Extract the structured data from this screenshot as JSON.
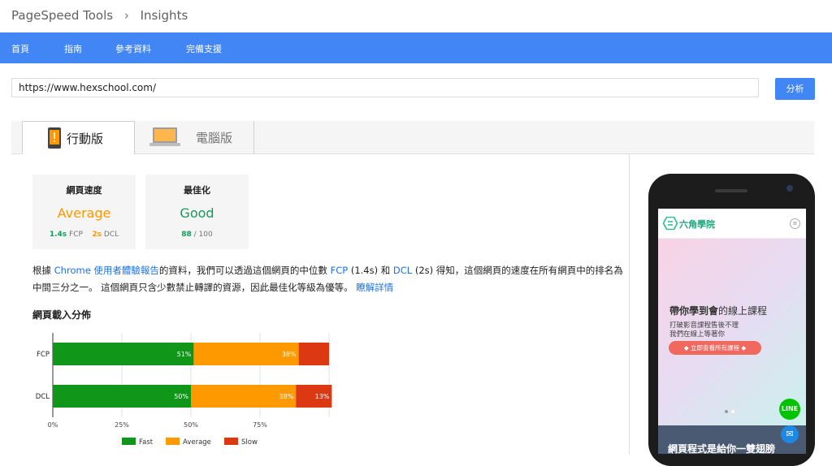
{
  "breadcrumb": {
    "root": "PageSpeed Tools",
    "separator": "›",
    "current": "Insights"
  },
  "nav": {
    "items": [
      "首頁",
      "指南",
      "參考資料",
      "完備支援"
    ]
  },
  "search": {
    "url": "https://www.hexschool.com/",
    "button_label": "分析"
  },
  "tabs": [
    {
      "label": "行動版",
      "icon": "mobile-phone-icon",
      "active": true
    },
    {
      "label": "電腦版",
      "icon": "laptop-icon",
      "active": false
    }
  ],
  "cards": {
    "speed": {
      "title": "網頁速度",
      "value": "Average",
      "fcp_value": "1.4s",
      "fcp_label": "FCP",
      "dcl_value": "2s",
      "dcl_label": "DCL",
      "color": "#ff9800"
    },
    "optimization": {
      "title": "最佳化",
      "value": "Good",
      "score": "88",
      "score_total": "/ 100",
      "color": "#0f9d58"
    }
  },
  "summary": {
    "p1": "根據 ",
    "link_report": "Chrome 使用者體驗報告",
    "p2": "的資料，我們可以透過這個網頁的中位數 ",
    "link_fcp": "FCP",
    "p3": " (1.4s) 和 ",
    "link_dcl": "DCL",
    "p4": " (2s) 得知，這個網頁的速度在所有網頁中的排名為中間三分之一。 這個網頁只含少數禁止轉譯的資源，因此最佳化等級為優等。 ",
    "link_more": "瞭解詳情"
  },
  "distribution": {
    "title": "網頁載入分佈"
  },
  "chart_data": {
    "type": "bar",
    "orientation": "horizontal",
    "stacked": true,
    "categories": [
      "FCP",
      "DCL"
    ],
    "series": [
      {
        "name": "Fast",
        "values": [
          51,
          50
        ],
        "labels": [
          "51%",
          "50%"
        ],
        "color": "#109618"
      },
      {
        "name": "Average",
        "values": [
          38,
          38
        ],
        "labels": [
          "38%",
          "38%"
        ],
        "color": "#ff9900"
      },
      {
        "name": "Slow",
        "values": [
          11,
          13
        ],
        "labels": [
          "",
          "13%"
        ],
        "color": "#dc3912"
      }
    ],
    "x_ticks": [
      "0%",
      "25%",
      "50%",
      "75%"
    ],
    "xlim": [
      0,
      100
    ],
    "grid": true,
    "legend_position": "bottom"
  },
  "phone_preview": {
    "logo_text": "六角學院",
    "hero_title_bold": "帶你學到會",
    "hero_title_rest": "的線上課程",
    "hero_line1": "打破影音課程售後不理",
    "hero_line2": "我們在線上等著你",
    "cta_label": "立即查看所有課程",
    "line_badge": "LINE",
    "bottom_text": "網頁程式是給你一雙翅膀"
  },
  "colors": {
    "nav_bg": "#4285f4",
    "link": "#1a73e8",
    "fast": "#109618",
    "average": "#ff9900",
    "slow": "#dc3912"
  }
}
